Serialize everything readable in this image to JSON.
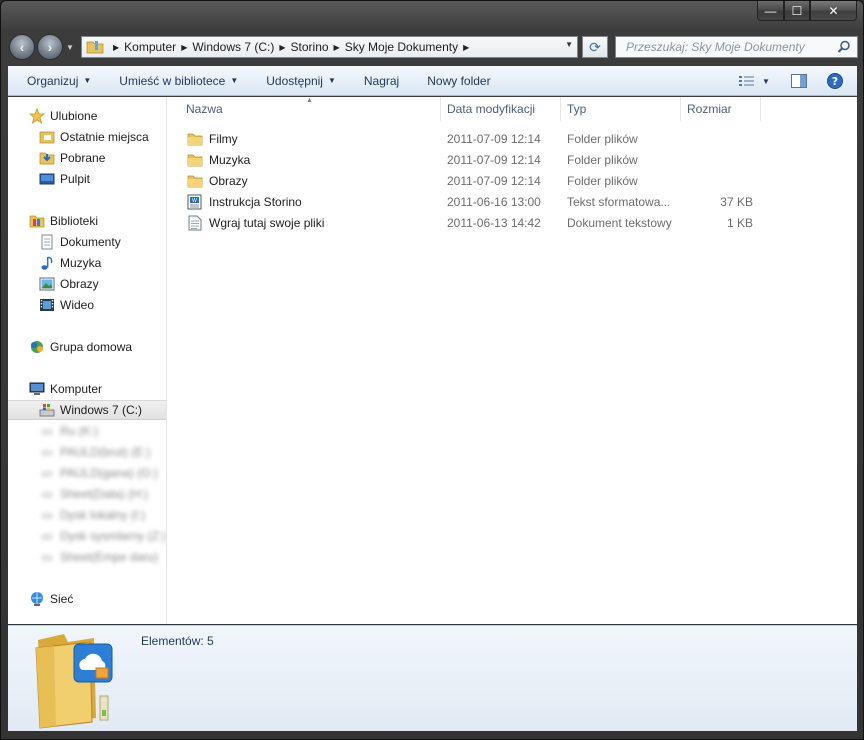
{
  "window": {
    "caption": {
      "minimize_glyph": "—",
      "maximize_glyph": "☐",
      "close_glyph": "✕"
    }
  },
  "address": {
    "breadcrumbs": [
      "Komputer",
      "Windows 7 (C:)",
      "Storino",
      "Sky Moje Dokumenty"
    ],
    "search_placeholder": "Przeszukaj: Sky Moje Dokumenty"
  },
  "toolbar": {
    "organize": "Organizuj",
    "library": "Umieść w bibliotece",
    "share": "Udostępnij",
    "burn": "Nagraj",
    "new_folder": "Nowy folder"
  },
  "nav": {
    "favorites": "Ulubione",
    "fav_items": [
      "Ostatnie miejsca",
      "Pobrane",
      "Pulpit"
    ],
    "libraries": "Biblioteki",
    "lib_items": [
      "Dokumenty",
      "Muzyka",
      "Obrazy",
      "Wideo"
    ],
    "homegroup": "Grupa domowa",
    "computer": "Komputer",
    "drive_selected": "Windows 7 (C:)",
    "blurred_items": [
      "Ru (K:)",
      "PAULD(brut) (E:)",
      "PAULD(gana) (G:)",
      "Sheet(Data) (H:)",
      "Dysk lokalny (I:)",
      "Dysk sysmlarny (Z:)",
      "Sheet(Empe daru)"
    ],
    "network": "Sieć"
  },
  "columns": {
    "name": "Nazwa",
    "date": "Data modyfikacji",
    "type": "Typ",
    "size": "Rozmiar"
  },
  "files": [
    {
      "name": "Filmy",
      "date": "2011-07-09 12:14",
      "type": "Folder plików",
      "size": "",
      "icon": "folder-icon"
    },
    {
      "name": "Muzyka",
      "date": "2011-07-09 12:14",
      "type": "Folder plików",
      "size": "",
      "icon": "folder-icon"
    },
    {
      "name": "Obrazy",
      "date": "2011-07-09 12:14",
      "type": "Folder plików",
      "size": "",
      "icon": "folder-icon"
    },
    {
      "name": "Instrukcja Storino",
      "date": "2011-06-16 13:00",
      "type": "Tekst sformatowa...",
      "size": "37 KB",
      "icon": "rtf-document-icon"
    },
    {
      "name": "Wgraj tutaj swoje pliki",
      "date": "2011-06-13 14:42",
      "type": "Dokument tekstowy",
      "size": "1 KB",
      "icon": "text-document-icon"
    }
  ],
  "details": {
    "count_label": "Elementów: 5"
  },
  "colors": {
    "toolbar_text": "#1e395b",
    "header_text": "#4c607a",
    "meta_text": "#6d6d6d",
    "folder": "#e8c25a"
  }
}
